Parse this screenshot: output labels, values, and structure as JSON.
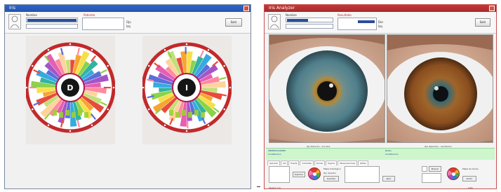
{
  "left_window": {
    "title": "Iris",
    "toolbar": {
      "field_label": "Nombre",
      "right_label": "Patiente",
      "small_a": "Ojo",
      "small_b": "Izq",
      "button": "Salir"
    },
    "charts": [
      {
        "letter": "D",
        "side": "right-eye-chart"
      },
      {
        "letter": "I",
        "side": "left-eye-chart"
      }
    ]
  },
  "right_window": {
    "title": "Iris Analyzer",
    "toolbar": {
      "field_label": "Nombre",
      "right_label": "Resultado",
      "small_a": "Der",
      "small_b": "Izq",
      "button": "Salir"
    },
    "captions": [
      "Ojo Derecho - Iris Azul",
      "Ojo Izquierdo - Iris Marron"
    ],
    "green_lines": [
      "OBSERVACIONES",
      "Constitucion",
      "Notas",
      "Constitucion"
    ],
    "tabs": [
      "General",
      "Iris",
      "Pupila",
      "Collarete",
      "Zonas",
      "Signos",
      "Observaciones",
      "Notas"
    ],
    "buttons": [
      "Imprimir",
      "Guardar",
      "Abrir",
      "Buscar",
      "Zoom"
    ],
    "panel_labels": [
      "Mapa Iridologico",
      "Ojo derecho",
      "Mapa de zonas"
    ],
    "footer": [
      "Version 2.0",
      "Listo"
    ]
  },
  "colors": {
    "titlebar_blue": "#2553ad",
    "titlebar_red": "#a62a2a",
    "green_band": "#cdf6cd",
    "chart_ring": "#c2292b"
  }
}
